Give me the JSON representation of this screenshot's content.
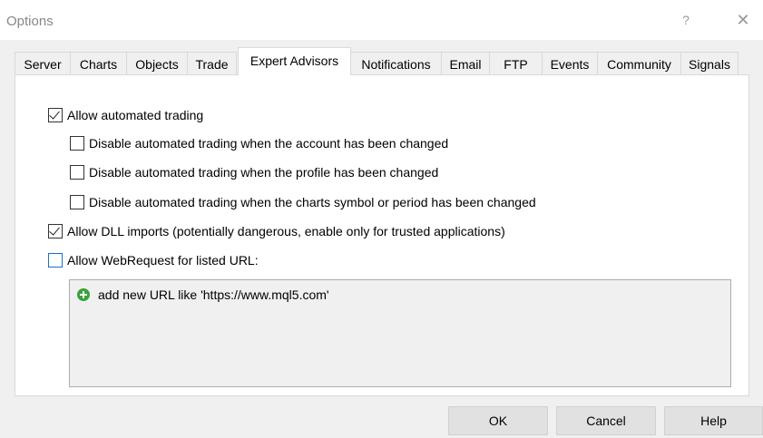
{
  "window": {
    "title": "Options",
    "help_glyph": "?",
    "close_glyph": "✕"
  },
  "tabs": [
    {
      "label": "Server"
    },
    {
      "label": "Charts"
    },
    {
      "label": "Objects"
    },
    {
      "label": "Trade"
    },
    {
      "label": "Expert Advisors",
      "active": true
    },
    {
      "label": "Notifications"
    },
    {
      "label": "Email"
    },
    {
      "label": "FTP"
    },
    {
      "label": "Events"
    },
    {
      "label": "Community"
    },
    {
      "label": "Signals"
    }
  ],
  "options": {
    "allow_automated_trading": {
      "label": "Allow automated trading",
      "checked": true
    },
    "disable_on_account_change": {
      "label": "Disable automated trading when the account has been changed",
      "checked": false
    },
    "disable_on_profile_change": {
      "label": "Disable automated trading when the profile has been changed",
      "checked": false
    },
    "disable_on_symbol_change": {
      "label": "Disable automated trading when the charts symbol or period has been changed",
      "checked": false
    },
    "allow_dll_imports": {
      "label": "Allow DLL imports (potentially dangerous, enable only for trusted applications)",
      "checked": true
    },
    "allow_webrequest": {
      "label": "Allow WebRequest for listed URL:",
      "checked": false
    }
  },
  "url_list": {
    "add_label": "add new URL like 'https://www.mql5.com'",
    "icon": "add-circle-icon"
  },
  "buttons": {
    "ok": "OK",
    "cancel": "Cancel",
    "help": "Help"
  },
  "colors": {
    "focus_border": "#1a6fc9",
    "add_icon": "#39a13c"
  }
}
